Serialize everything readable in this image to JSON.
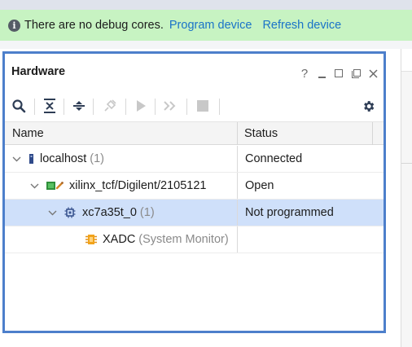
{
  "banner": {
    "message": "There are no debug cores.",
    "program_link": "Program device",
    "refresh_link": "Refresh device",
    "bg_color": "#c7f3c2",
    "link_color": "#1a73c8"
  },
  "panel": {
    "title": "Hardware",
    "help_label": "?",
    "border_color": "#4d7fcb"
  },
  "toolbar": {
    "icons": [
      "search-icon",
      "collapse-all-icon",
      "expand-all-icon",
      "auto-connect-icon",
      "run-trigger-icon",
      "run-trigger-immediate-icon",
      "stop-trigger-icon",
      "settings-icon"
    ]
  },
  "table": {
    "columns": {
      "name": "Name",
      "status": "Status"
    },
    "rows": [
      {
        "name": "localhost",
        "count": "(1)",
        "status": "Connected",
        "icon": "host-icon",
        "expanded": true
      },
      {
        "name": "xilinx_tcf/Digilent/2105121",
        "count": "",
        "status": "Open",
        "icon": "target-board-icon",
        "expanded": true
      },
      {
        "name": "xc7a35t_0",
        "count": "(1)",
        "status": "Not programmed",
        "icon": "fpga-chip-icon",
        "expanded": true,
        "selected": true
      },
      {
        "name": "XADC",
        "count": "(System Monitor)",
        "status": "",
        "icon": "xadc-icon"
      }
    ]
  },
  "colors": {
    "selection": "#cfe0fa",
    "muted_text": "#8a8a8a"
  }
}
